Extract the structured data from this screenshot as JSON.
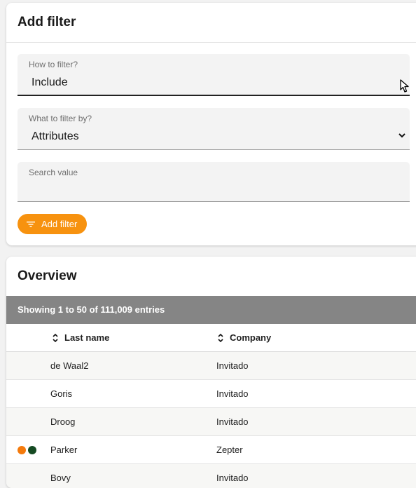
{
  "filter_card": {
    "title": "Add filter",
    "how": {
      "label": "How to filter?",
      "value": "Include"
    },
    "what": {
      "label": "What to filter by?",
      "value": "Attributes"
    },
    "search": {
      "label": "Search value",
      "value": ""
    },
    "add_button": "Add filter"
  },
  "overview": {
    "title": "Overview",
    "entries_text": "Showing 1 to 50 of 111,009 entries",
    "columns": [
      "Last name",
      "Company"
    ],
    "rows": [
      {
        "last_name": "de Waal2",
        "company": "Invitado",
        "dots": []
      },
      {
        "last_name": "Goris",
        "company": "Invitado",
        "dots": []
      },
      {
        "last_name": "Droog",
        "company": "Invitado",
        "dots": []
      },
      {
        "last_name": "Parker",
        "company": "Zepter",
        "dots": [
          "#f47a0c",
          "#154a22"
        ]
      },
      {
        "last_name": "Bovy",
        "company": "Invitado",
        "dots": []
      }
    ]
  },
  "colors": {
    "accent": "#f7920f",
    "entries_bar": "#858585"
  },
  "icons": {
    "filter": "filter-lines-icon",
    "sort": "sort-arrows-icon",
    "chevron": "chevron-down-icon",
    "cursor": "mouse-cursor-icon"
  }
}
